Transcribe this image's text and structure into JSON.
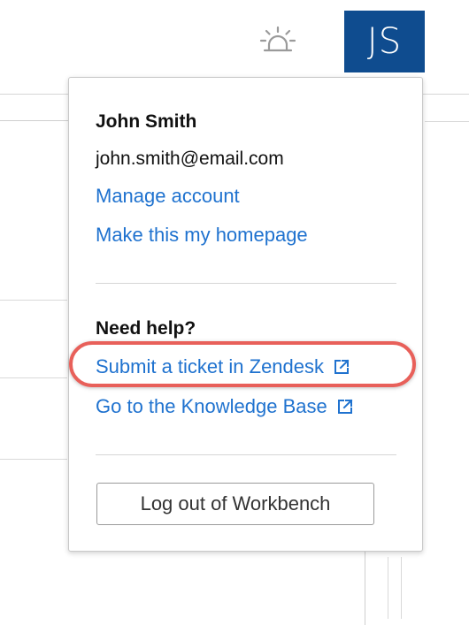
{
  "header": {
    "alert_icon": "siren-icon",
    "avatar_initials": "JS",
    "avatar_color": "#0f4c8f"
  },
  "account_menu": {
    "user_name": "John Smith",
    "user_email": "john.smith@email.com",
    "manage_account_label": "Manage account",
    "homepage_label": "Make this my homepage",
    "help_title": "Need help?",
    "zendesk_label": "Submit a ticket in Zendesk",
    "knowledge_base_label": "Go to the Knowledge Base",
    "external_link_icon": "external-link-icon",
    "logout_label": "Log out of Workbench",
    "link_color": "#1f72cf",
    "highlight_color": "#e8605a"
  }
}
